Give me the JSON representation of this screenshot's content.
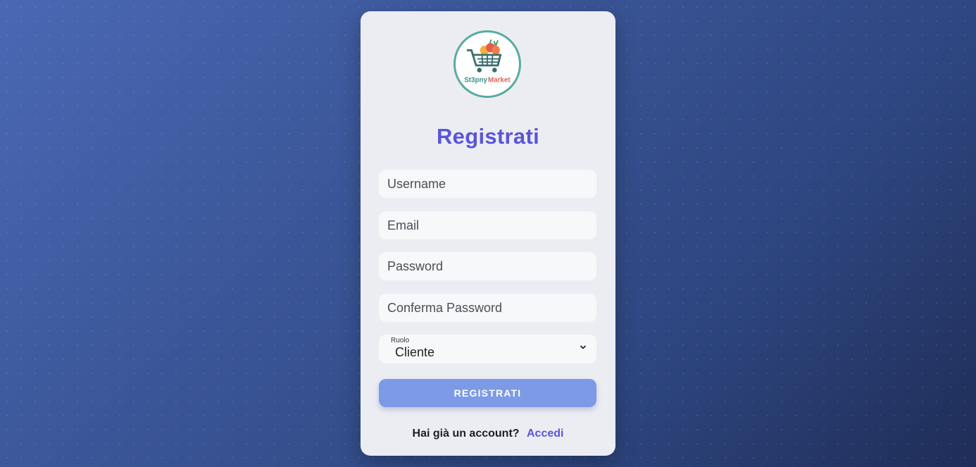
{
  "brand": {
    "logo_text_part1": "St3pny",
    "logo_text_part2": "Market"
  },
  "form": {
    "title": "Registrati",
    "username_placeholder": "Username",
    "email_placeholder": "Email",
    "password_placeholder": "Password",
    "confirm_password_placeholder": "Conferma Password",
    "role": {
      "label": "Ruolo",
      "selected": "Cliente"
    },
    "submit_label": "REGISTRATI"
  },
  "footer": {
    "prompt": "Hai già un account?",
    "login_link": "Accedi"
  },
  "colors": {
    "accent": "#5a55d9",
    "button": "#7c9ae6",
    "logo_ring": "#56aba1",
    "logo_market": "#e0625a"
  },
  "icons": {
    "logo": "shopping-cart-icon",
    "select_chevron": "chevron-down-icon"
  }
}
